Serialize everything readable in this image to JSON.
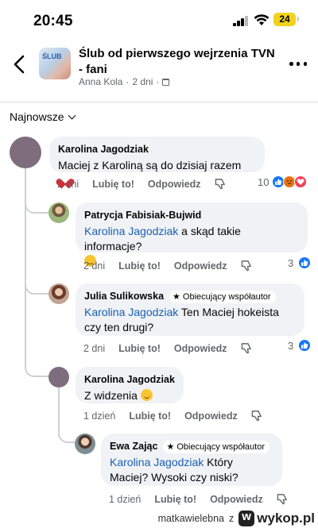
{
  "status_bar": {
    "time": "20:45",
    "battery": "24"
  },
  "header": {
    "title": "Ślub od pierwszego wejrzenia TVN - fani",
    "author": "Anna Kola",
    "time": "2 dni",
    "thumb_text": "ŚLUB"
  },
  "sort": {
    "label": "Najnowsze"
  },
  "actions_labels": {
    "like": "Lubię to!",
    "reply": "Odpowiedz"
  },
  "comments": [
    {
      "author": "Karolina Jagodziak",
      "text": "Maciej z Karoliną są do dzisiaj razem",
      "time": "2 dni",
      "reaction_count": "10",
      "reactions": [
        "like-icon",
        "love-icon",
        "angry-icon"
      ]
    },
    {
      "author": "Patrycja Fabisiak-Bujwid",
      "mention": "Karolina Jagodziak",
      "text": " a skąd takie informacje?",
      "time": "2 dni",
      "reaction_count": "3"
    },
    {
      "author": "Julia Sulikowska",
      "badge": "Obiecujący współautor",
      "mention": "Karolina Jagodziak",
      "text": " Ten Maciej hokeista czy ten drugi?",
      "time": "2 dni",
      "reaction_count": "3"
    },
    {
      "author": "Karolina Jagodziak",
      "text": "Z widzenia",
      "time": "1 dzień"
    },
    {
      "author": "Ewa Zając",
      "badge": "Obiecujący współautor",
      "mention": "Karolina Jagodziak",
      "text": " Który Maciej? Wysoki czy niski?",
      "time": "1 dzień"
    }
  ],
  "watermark": {
    "user": "matkawielebna",
    "sep": "z",
    "site": "wykop.pl"
  },
  "colors": {
    "mention": "#1a5fb4",
    "bubble": "#f0f2f5",
    "like": "#1877f2",
    "love": "#f33e58",
    "angry": "#e9710f"
  }
}
